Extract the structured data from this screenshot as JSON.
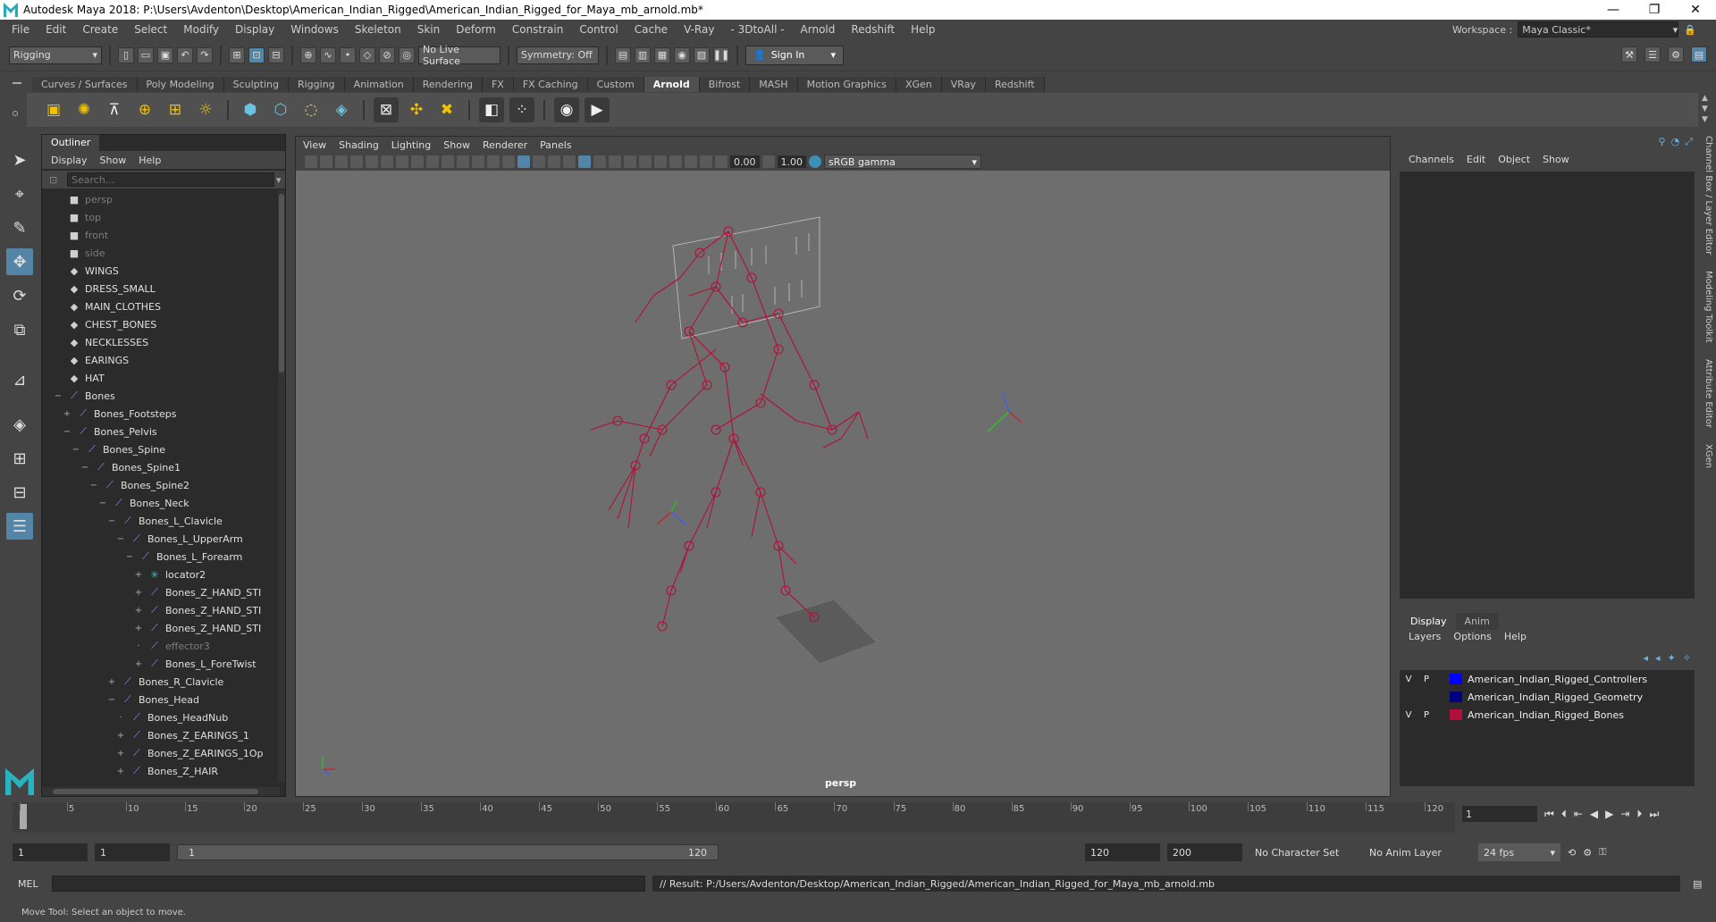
{
  "window": {
    "title": "Autodesk Maya 2018: P:\\Users\\Avdenton\\Desktop\\American_Indian_Rigged\\American_Indian_Rigged_for_Maya_mb_arnold.mb*",
    "min": "—",
    "max": "❐",
    "close": "✕"
  },
  "menubar": [
    "File",
    "Edit",
    "Create",
    "Select",
    "Modify",
    "Display",
    "Windows",
    "Skeleton",
    "Skin",
    "Deform",
    "Constrain",
    "Control",
    "Cache",
    "V-Ray",
    "- 3DtoAll -",
    "Arnold",
    "Redshift",
    "Help"
  ],
  "workspace": {
    "label": "Workspace :",
    "value": "Maya Classic*"
  },
  "statusline": {
    "mode": "Rigging",
    "live_surface": "No Live Surface",
    "symmetry": "Symmetry: Off",
    "sign_in": "Sign In"
  },
  "shelf": {
    "tabs": [
      "Curves / Surfaces",
      "Poly Modeling",
      "Sculpting",
      "Rigging",
      "Animation",
      "Rendering",
      "FX",
      "FX Caching",
      "Custom",
      "Arnold",
      "Bifrost",
      "MASH",
      "Motion Graphics",
      "XGen",
      "VRay",
      "Redshift"
    ],
    "active_tab": "Arnold"
  },
  "outliner": {
    "tab": "Outliner",
    "menu": [
      "Display",
      "Show",
      "Help"
    ],
    "search_placeholder": "Search...",
    "items": [
      {
        "label": "persp",
        "depth": 0,
        "exp": "",
        "icon": "camera",
        "dim": true
      },
      {
        "label": "top",
        "depth": 0,
        "exp": "",
        "icon": "camera",
        "dim": true
      },
      {
        "label": "front",
        "depth": 0,
        "exp": "",
        "icon": "camera",
        "dim": true
      },
      {
        "label": "side",
        "depth": 0,
        "exp": "",
        "icon": "camera",
        "dim": true
      },
      {
        "label": "WINGS",
        "depth": 0,
        "exp": "",
        "icon": "set",
        "dim": false
      },
      {
        "label": "DRESS_SMALL",
        "depth": 0,
        "exp": "",
        "icon": "set",
        "dim": false
      },
      {
        "label": "MAIN_CLOTHES",
        "depth": 0,
        "exp": "",
        "icon": "set",
        "dim": false
      },
      {
        "label": "CHEST_BONES",
        "depth": 0,
        "exp": "",
        "icon": "set",
        "dim": false
      },
      {
        "label": "NECKLESSES",
        "depth": 0,
        "exp": "",
        "icon": "set",
        "dim": false
      },
      {
        "label": "EARINGS",
        "depth": 0,
        "exp": "",
        "icon": "set",
        "dim": false
      },
      {
        "label": "HAT",
        "depth": 0,
        "exp": "",
        "icon": "set",
        "dim": false
      },
      {
        "label": "Bones",
        "depth": 0,
        "exp": "−",
        "icon": "joint",
        "dim": false
      },
      {
        "label": "Bones_Footsteps",
        "depth": 1,
        "exp": "+",
        "icon": "joint",
        "dim": false
      },
      {
        "label": "Bones_Pelvis",
        "depth": 1,
        "exp": "−",
        "icon": "joint",
        "dim": false
      },
      {
        "label": "Bones_Spine",
        "depth": 2,
        "exp": "−",
        "icon": "joint",
        "dim": false
      },
      {
        "label": "Bones_Spine1",
        "depth": 3,
        "exp": "−",
        "icon": "joint",
        "dim": false
      },
      {
        "label": "Bones_Spine2",
        "depth": 4,
        "exp": "−",
        "icon": "joint",
        "dim": false
      },
      {
        "label": "Bones_Neck",
        "depth": 5,
        "exp": "−",
        "icon": "joint",
        "dim": false
      },
      {
        "label": "Bones_L_Clavicle",
        "depth": 6,
        "exp": "−",
        "icon": "joint",
        "dim": false
      },
      {
        "label": "Bones_L_UpperArm",
        "depth": 7,
        "exp": "−",
        "icon": "joint",
        "dim": false
      },
      {
        "label": "Bones_L_Forearm",
        "depth": 8,
        "exp": "−",
        "icon": "joint",
        "dim": false
      },
      {
        "label": "locator2",
        "depth": 9,
        "exp": "+",
        "icon": "locator",
        "dim": false
      },
      {
        "label": "Bones_Z_HAND_STI",
        "depth": 9,
        "exp": "+",
        "icon": "joint",
        "dim": false
      },
      {
        "label": "Bones_Z_HAND_STI",
        "depth": 9,
        "exp": "+",
        "icon": "joint",
        "dim": false
      },
      {
        "label": "Bones_Z_HAND_STI",
        "depth": 9,
        "exp": "+",
        "icon": "joint",
        "dim": false
      },
      {
        "label": "effector3",
        "depth": 9,
        "exp": "·",
        "icon": "effector",
        "dim": true
      },
      {
        "label": "Bones_L_ForeTwist",
        "depth": 9,
        "exp": "+",
        "icon": "joint",
        "dim": false
      },
      {
        "label": "Bones_R_Clavicle",
        "depth": 6,
        "exp": "+",
        "icon": "joint",
        "dim": false
      },
      {
        "label": "Bones_Head",
        "depth": 6,
        "exp": "−",
        "icon": "joint",
        "dim": false
      },
      {
        "label": "Bones_HeadNub",
        "depth": 7,
        "exp": "·",
        "icon": "joint",
        "dim": false
      },
      {
        "label": "Bones_Z_EARINGS_1",
        "depth": 7,
        "exp": "+",
        "icon": "joint",
        "dim": false
      },
      {
        "label": "Bones_Z_EARINGS_1Op",
        "depth": 7,
        "exp": "+",
        "icon": "joint",
        "dim": false
      },
      {
        "label": "Bones_Z_HAIR",
        "depth": 7,
        "exp": "+",
        "icon": "joint",
        "dim": false
      }
    ]
  },
  "viewport": {
    "menu": [
      "View",
      "Shading",
      "Lighting",
      "Show",
      "Renderer",
      "Panels"
    ],
    "exposure": "0.00",
    "gamma": "1.00",
    "color_space": "sRGB gamma",
    "camera": "persp",
    "rig_color": "#b0103a"
  },
  "channelbox": {
    "menu": [
      "Channels",
      "Edit",
      "Object",
      "Show"
    ],
    "layer_tabs": [
      "Display",
      "Anim"
    ],
    "layer_menu": [
      "Layers",
      "Options",
      "Help"
    ],
    "layers": [
      {
        "v": "V",
        "p": "P",
        "name": "American_Indian_Rigged_Controllers",
        "color": "#0000ff"
      },
      {
        "v": "",
        "p": "",
        "name": "American_Indian_Rigged_Geometry",
        "color": "#000080"
      },
      {
        "v": "V",
        "p": "P",
        "name": "American_Indian_Rigged_Bones",
        "color": "#b0103a"
      }
    ],
    "side_tabs": [
      "Channel Box / Layer Editor",
      "Modeling Toolkit",
      "Attribute Editor",
      "XGen"
    ]
  },
  "timeslider": {
    "ticks": [
      "1",
      "5",
      "10",
      "15",
      "20",
      "25",
      "30",
      "35",
      "40",
      "45",
      "50",
      "55",
      "60",
      "65",
      "70",
      "75",
      "80",
      "85",
      "90",
      "95",
      "100",
      "105",
      "110",
      "115",
      "120"
    ],
    "current_frame": "1"
  },
  "range": {
    "start": "1",
    "playback_start": "1",
    "slider_start": "1",
    "slider_end": "120",
    "playback_end": "120",
    "end": "200",
    "character_set": "No Character Set",
    "anim_layer": "No Anim Layer",
    "fps": "24 fps"
  },
  "command": {
    "language": "MEL",
    "result": "// Result: P:/Users/Avdenton/Desktop/American_Indian_Rigged/American_Indian_Rigged_for_Maya_mb_arnold.mb"
  },
  "helpline": "Move Tool: Select an object to move."
}
